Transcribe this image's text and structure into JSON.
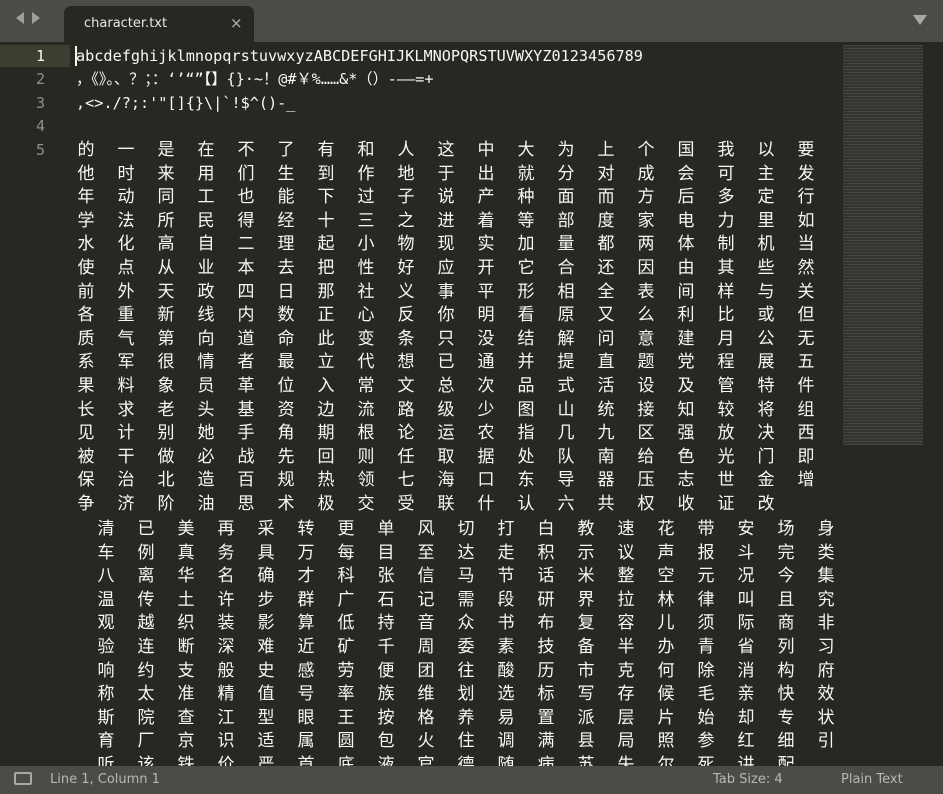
{
  "tab": {
    "title": "character.txt",
    "close_glyph": "×"
  },
  "gutter": {
    "line_numbers": [
      "1",
      "2",
      "3",
      "4",
      "5"
    ]
  },
  "editor": {
    "line1": "abcdefghijklmnopqrstuvwxyzABCDEFGHIJKLMNOPQRSTUVWXYZ0123456789",
    "line2": "，《》。、？；：‘’“”【】{}·~！@#￥%……&*（）-——=+",
    "line3": ",<>./?;:'\"[]{}\\|`!$^()-_",
    "line4": "",
    "line5_block_a": "的一是在不了有和人这中大为上个国我以要他时来用们生到作地于出就分对成会可主发年动同工也能下过子说产种面而方后多定行学法所民得经十三之进着等部度家电力里如水化高自二理起小物现实加量都两体制机当使点从业本去把性好应开它合还因由其些然前外天政四日那社义事平形相全表间样与关各重新线内数正心反你明看原又么利比或但质气第向道命此变条只没结解问意建月公无系军很情者最立代想已通并提直题党程展五果料象员革位入常文总次品式活设及管特件长求老头基资边流路级少图山统接知较将组见计别她手角期根论运农指几九区强放决西被干做必战先回则任取据处队南给色光门即保治北造百规热领七海口东导器压志世金增争济阶油思术极交受联什认六共权收证改清美再采转更单风切打白教速花带安场身车例真务具万每目至达走积示议声报斗完类八离华名确才科张信马节话米整空元况今集温传土许步群广石记需段研界拉林律叫且究观越织装影算低持音众书布复容儿须际商非验连断深难近矿千周委素技备半办青省列习响约支般史感劳便团往酸历市克何除消构府称太准精值号率族维划选标写存候毛亲快效斯院查江型眼王按格养易置派层片始却专状育厂京识适属圆包火住调满县局照参红细引听该铁价严首底液官德随病苏失尔死讲配",
    "line5_block_b": "清已美再采转更单风切打白教速花带安场身车例真务具万每目至达走积示议声报斗完类八离华名确才科张信马节话米整空元况今集温传土许步群广石记需段研界拉林律叫且究观越织装影算低持音众书布复容儿须际商非验连断深难近矿千周委素技备半办青省列习响约支般史感劳便团往酸历市克何除消构府称太准精值号率族维划选标写存候毛亲快效斯院查江型眼王按格养易置派层片始却专状育厂京识适属圆包火住调满县局照参红细引听该铁价严首底液官德随病苏失尔死讲配"
  },
  "hanzi_a": "的一是在不了有和人这中大为上个国我以要他时来用们生到作地于出就分对成会可主发年动同工也能下过子说产种面而方后多定行学法所民得经十三之进着等部度家电力里如水化高自二理起小物现实加量都两体制机当使点从业本去把性好应开它合还因由其些然前外天政四日那社义事平形相全表间样与关各重新线内数正心反你明看原又么利比或但质气第向道命此变条只没结解问意建月公无系军很情者最立代想已通并提直题党程展五果料象员革位入常文总次品式活设及管特件长求老头基资边流路级少图山统接知较将组见计别她手角期根论运农指几九区强放决西被干做必战先回则任取据处队南给色光门即保治北造百规热领七海口东导器压志世金增争济阶油思术极交受联什认六共权收证改",
  "hanzi_b": "清已美再采转更单风切打白教速花带安场身车例真务具万每目至达走积示议声报斗完类八离华名确才科张信马节话米整空元况今集温传土许步群广石记需段研界拉林律叫且究观越织装影算低持音众书布复容儿须际商非验连断深难近矿千周委素技备半办青省列习响约支般史感劳便团往酸历市克何除消构府称太准精值号率族维划选标写存候毛亲快效斯院查江型眼王按格养易置派层片始却专状育厂京识适属圆包火住调满县局照参红细引听该铁价严首底液官德随病苏失尔死讲配",
  "status": {
    "position": "Line 1, Column 1",
    "tab_size": "Tab Size: 4",
    "syntax": "Plain Text"
  },
  "colors": {
    "editor_bg": "#272822",
    "chrome_bg": "#4b4c46",
    "text": "#f8f8f2",
    "gutter_text": "#8f908a"
  },
  "icons": [
    "arrow-left-icon",
    "arrow-right-icon",
    "close-icon",
    "tab-menu-icon",
    "panel-icon"
  ]
}
